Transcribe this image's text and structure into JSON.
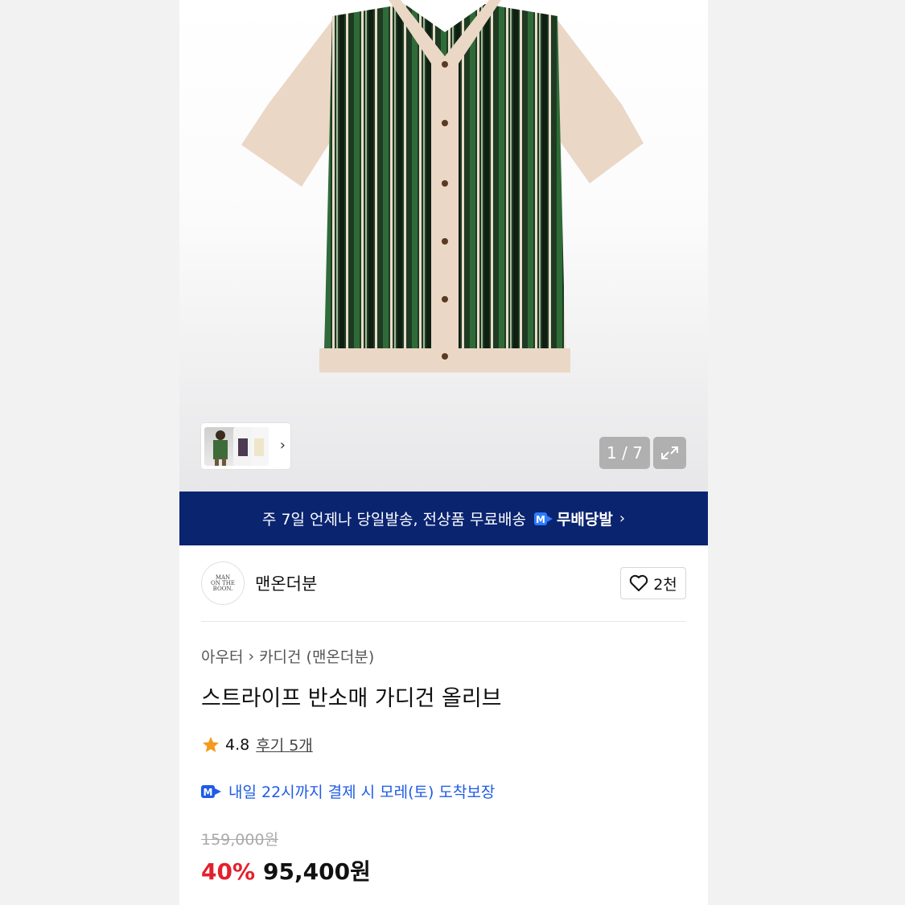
{
  "gallery": {
    "counter": "1 / 7"
  },
  "banner": {
    "text": "주 7일 언제나 당일발송, 전상품 무료배송",
    "badge_letter": "M",
    "brand": "무배당발"
  },
  "seller": {
    "logo_lines": [
      "MAN",
      "ON THE",
      "BOON."
    ],
    "name": "맨온더분",
    "likes": "2천"
  },
  "breadcrumb": {
    "level1": "아우터",
    "level2": "카디건 (맨온더분)"
  },
  "product": {
    "title": "스트라이프 반소매 가디건 올리브",
    "rating": "4.8",
    "reviews_label": "후기 5개",
    "delivery": "내일 22시까지 결제 시 모레(토) 도착보장",
    "original_price": "159,000원",
    "discount": "40%",
    "price": "95,400원"
  },
  "colors": {
    "banner_bg": "#0a2470",
    "accent_blue": "#1e5be6",
    "discount_red": "#e3202c",
    "star": "#f59a1b"
  }
}
